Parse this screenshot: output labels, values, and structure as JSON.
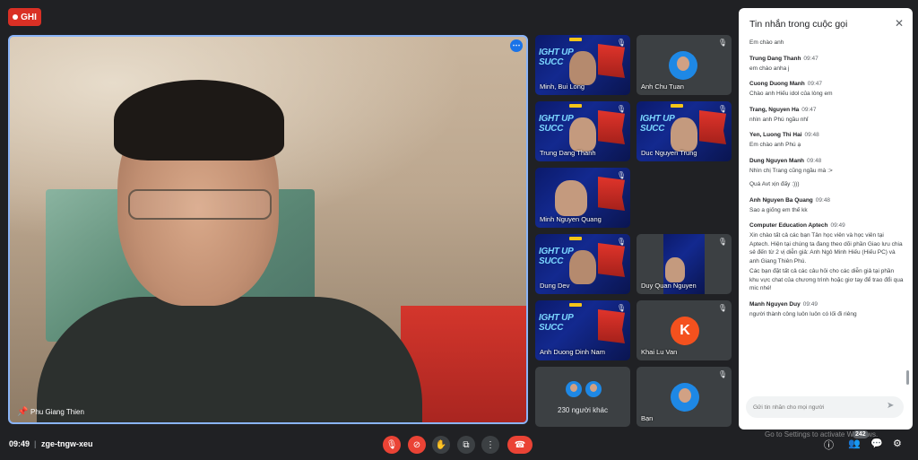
{
  "recording": {
    "label": "GHI"
  },
  "main_speaker": {
    "name": "Phu Giang Thien"
  },
  "tiles": [
    {
      "name": "Minh, Bui Long",
      "type": "banner"
    },
    {
      "name": "Anh Chu Tuan",
      "type": "avatar"
    },
    {
      "name": "Trung Dang Thanh",
      "type": "banner"
    },
    {
      "name": "Duc Nguyen Trung",
      "type": "banner"
    },
    {
      "name": "Minh Nguyen Quang",
      "type": "banner"
    },
    {
      "name": "Dung Dev",
      "type": "banner"
    },
    {
      "name": "Duy Quan Nguyen",
      "type": "banner"
    },
    {
      "name": "Anh Duong Dinh Nam",
      "type": "banner"
    },
    {
      "name": "Khai Lu Van",
      "type": "letter",
      "letter": "K"
    },
    {
      "name": "230 người khác",
      "type": "others"
    },
    {
      "name": "Bạn",
      "type": "avatar"
    }
  ],
  "banner_text": {
    "line1": "IGHT UP",
    "line2": "SUCC"
  },
  "bottom_bar": {
    "time": "09:49",
    "separator": "|",
    "meeting_code": "zge-tngw-xeu",
    "people_count": "242"
  },
  "chat": {
    "title": "Tin nhắn trong cuộc gọi",
    "input_placeholder": "Gửi tin nhắn cho mọi người",
    "messages": [
      {
        "sender": "",
        "time": "",
        "texts": [
          "Em chào anh"
        ]
      },
      {
        "sender": "Trung Dang Thanh",
        "time": "09:47",
        "texts": [
          "em chào anha j"
        ]
      },
      {
        "sender": "Cuong Duong Manh",
        "time": "09:47",
        "texts": [
          "Chào anh Hiếu idol của lòng em"
        ]
      },
      {
        "sender": "Trang, Nguyen Ha",
        "time": "09:47",
        "texts": [
          "nhìn anh Phú ngầu nhỉ"
        ]
      },
      {
        "sender": "Yen, Luong Thi Hai",
        "time": "09:48",
        "texts": [
          "Em chào anh Phú ạ"
        ]
      },
      {
        "sender": "Dung Nguyen Manh",
        "time": "09:48",
        "texts": [
          "Nhìn chị Trang cũng ngầu mà :>",
          "Quá Avt xịn đấy :)))"
        ]
      },
      {
        "sender": "Anh Nguyen Ba Quang",
        "time": "09:48",
        "texts": [
          "Sao a giống em thế kk"
        ]
      },
      {
        "sender": "Computer Education Aptech",
        "time": "09:49",
        "texts": [
          "Xin chào tất cả các bạn Tân học viên và học viên tại Aptech. Hiện tại chúng ta đang theo dõi phần Giao lưu chia sẻ đến từ 2 vị diễn giả: Anh Ngô Minh Hiếu (Hiếu PC) và anh Giang Thiên Phú.",
          "Các bạn đặt tất cả các câu hỏi cho các diễn giả tại phần khu vực chat của chương trình hoặc giơ tay để trao đổi qua mic nhé!"
        ]
      },
      {
        "sender": "Manh Nguyen Duy",
        "time": "09:49",
        "texts": [
          "người thành công luôn luôn có lối đi riêng"
        ]
      }
    ]
  },
  "watermark": {
    "line1": "Activate Windows",
    "line2": "Go to Settings to activate Windows."
  },
  "colors": {
    "accent": "#8ab4f8",
    "record": "#d93025",
    "hangup": "#ea4335",
    "background": "#202124"
  }
}
